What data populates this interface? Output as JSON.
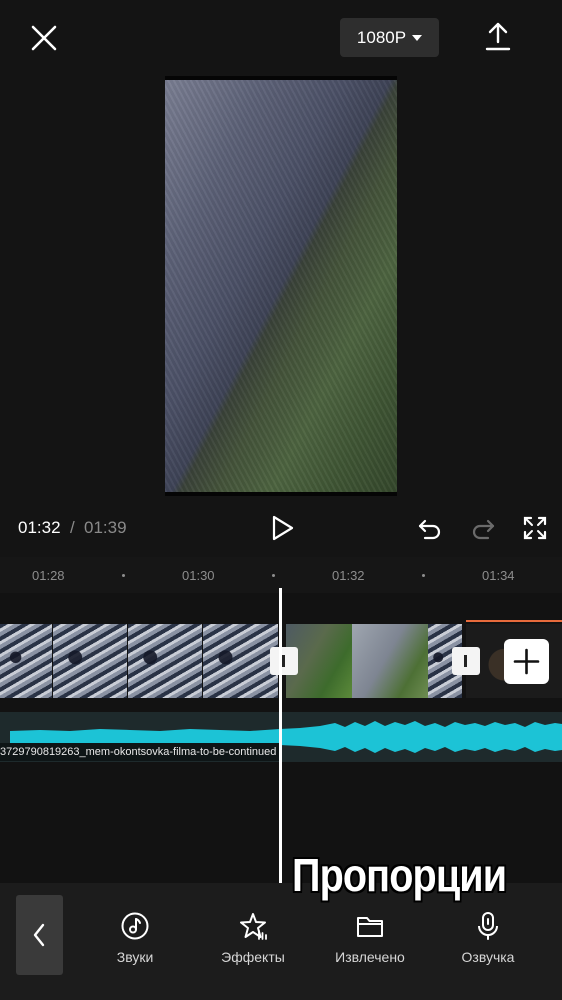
{
  "header": {
    "resolution_label": "1080P"
  },
  "transport": {
    "current_time": "01:32",
    "separator": "/",
    "total_time": "01:39"
  },
  "timeline": {
    "ruler": [
      "01:28",
      "01:30",
      "01:32",
      "01:34"
    ],
    "audio_clip_name": "3729790819263_mem-okontsovka-filma-to-be-continued"
  },
  "toolbar": {
    "items": [
      {
        "label": "Звуки",
        "icon": "music-note-icon"
      },
      {
        "label": "Эффекты",
        "icon": "star-sparkle-icon"
      },
      {
        "label": "Извлечено",
        "icon": "folder-icon"
      },
      {
        "label": "Озвучка",
        "icon": "microphone-icon"
      }
    ]
  },
  "overlay_caption": "Пропорции",
  "colors": {
    "background": "#141414",
    "waveform": "#1cc3d6",
    "trim_marker": "#e86b3c"
  }
}
